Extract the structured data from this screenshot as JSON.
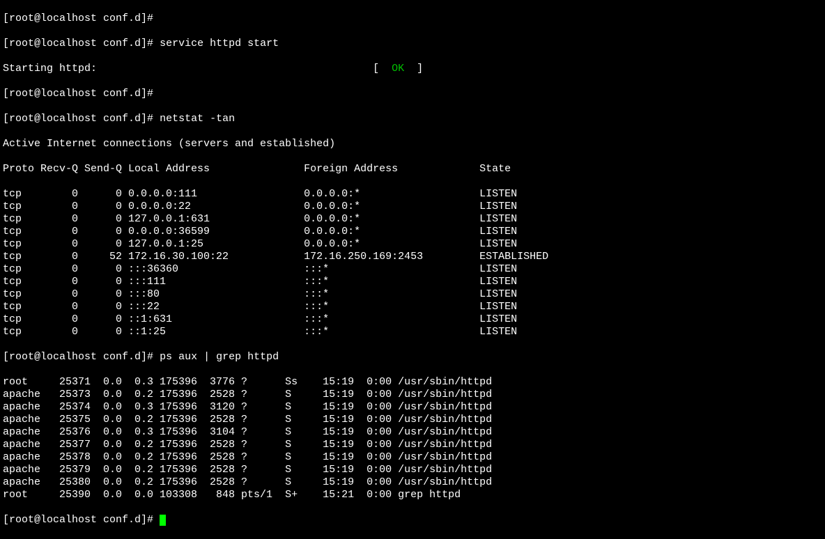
{
  "prompt": "[root@localhost conf.d]#",
  "cmd_service": "service httpd start",
  "starting_line": "Starting httpd:",
  "ok_left": "[",
  "ok_text": "  OK  ",
  "ok_right": "]",
  "cmd_netstat": "netstat -tan",
  "netstat_title": "Active Internet connections (servers and established)",
  "netstat_header": {
    "proto": "Proto",
    "recvq": "Recv-Q",
    "sendq": "Send-Q",
    "local": "Local Address",
    "foreign": "Foreign Address",
    "state": "State"
  },
  "netstat_rows": [
    {
      "proto": "tcp",
      "recvq": "0",
      "sendq": "0",
      "local": "0.0.0.0:111",
      "foreign": "0.0.0.0:*",
      "state": "LISTEN"
    },
    {
      "proto": "tcp",
      "recvq": "0",
      "sendq": "0",
      "local": "0.0.0.0:22",
      "foreign": "0.0.0.0:*",
      "state": "LISTEN"
    },
    {
      "proto": "tcp",
      "recvq": "0",
      "sendq": "0",
      "local": "127.0.0.1:631",
      "foreign": "0.0.0.0:*",
      "state": "LISTEN"
    },
    {
      "proto": "tcp",
      "recvq": "0",
      "sendq": "0",
      "local": "0.0.0.0:36599",
      "foreign": "0.0.0.0:*",
      "state": "LISTEN"
    },
    {
      "proto": "tcp",
      "recvq": "0",
      "sendq": "0",
      "local": "127.0.0.1:25",
      "foreign": "0.0.0.0:*",
      "state": "LISTEN"
    },
    {
      "proto": "tcp",
      "recvq": "0",
      "sendq": "52",
      "local": "172.16.30.100:22",
      "foreign": "172.16.250.169:2453",
      "state": "ESTABLISHED"
    },
    {
      "proto": "tcp",
      "recvq": "0",
      "sendq": "0",
      "local": ":::36360",
      "foreign": ":::*",
      "state": "LISTEN"
    },
    {
      "proto": "tcp",
      "recvq": "0",
      "sendq": "0",
      "local": ":::111",
      "foreign": ":::*",
      "state": "LISTEN"
    },
    {
      "proto": "tcp",
      "recvq": "0",
      "sendq": "0",
      "local": ":::80",
      "foreign": ":::*",
      "state": "LISTEN"
    },
    {
      "proto": "tcp",
      "recvq": "0",
      "sendq": "0",
      "local": ":::22",
      "foreign": ":::*",
      "state": "LISTEN"
    },
    {
      "proto": "tcp",
      "recvq": "0",
      "sendq": "0",
      "local": "::1:631",
      "foreign": ":::*",
      "state": "LISTEN"
    },
    {
      "proto": "tcp",
      "recvq": "0",
      "sendq": "0",
      "local": "::1:25",
      "foreign": ":::*",
      "state": "LISTEN"
    }
  ],
  "cmd_ps": "ps aux | grep httpd",
  "ps_rows": [
    {
      "user": "root",
      "pid": "25371",
      "cpu": "0.0",
      "mem": "0.3",
      "vsz": "175396",
      "rss": "3776",
      "tty": "?",
      "stat": "Ss",
      "start": "15:19",
      "time": "0:00",
      "cmd": "/usr/sbin/httpd"
    },
    {
      "user": "apache",
      "pid": "25373",
      "cpu": "0.0",
      "mem": "0.2",
      "vsz": "175396",
      "rss": "2528",
      "tty": "?",
      "stat": "S",
      "start": "15:19",
      "time": "0:00",
      "cmd": "/usr/sbin/httpd"
    },
    {
      "user": "apache",
      "pid": "25374",
      "cpu": "0.0",
      "mem": "0.3",
      "vsz": "175396",
      "rss": "3120",
      "tty": "?",
      "stat": "S",
      "start": "15:19",
      "time": "0:00",
      "cmd": "/usr/sbin/httpd"
    },
    {
      "user": "apache",
      "pid": "25375",
      "cpu": "0.0",
      "mem": "0.2",
      "vsz": "175396",
      "rss": "2528",
      "tty": "?",
      "stat": "S",
      "start": "15:19",
      "time": "0:00",
      "cmd": "/usr/sbin/httpd"
    },
    {
      "user": "apache",
      "pid": "25376",
      "cpu": "0.0",
      "mem": "0.3",
      "vsz": "175396",
      "rss": "3104",
      "tty": "?",
      "stat": "S",
      "start": "15:19",
      "time": "0:00",
      "cmd": "/usr/sbin/httpd"
    },
    {
      "user": "apache",
      "pid": "25377",
      "cpu": "0.0",
      "mem": "0.2",
      "vsz": "175396",
      "rss": "2528",
      "tty": "?",
      "stat": "S",
      "start": "15:19",
      "time": "0:00",
      "cmd": "/usr/sbin/httpd"
    },
    {
      "user": "apache",
      "pid": "25378",
      "cpu": "0.0",
      "mem": "0.2",
      "vsz": "175396",
      "rss": "2528",
      "tty": "?",
      "stat": "S",
      "start": "15:19",
      "time": "0:00",
      "cmd": "/usr/sbin/httpd"
    },
    {
      "user": "apache",
      "pid": "25379",
      "cpu": "0.0",
      "mem": "0.2",
      "vsz": "175396",
      "rss": "2528",
      "tty": "?",
      "stat": "S",
      "start": "15:19",
      "time": "0:00",
      "cmd": "/usr/sbin/httpd"
    },
    {
      "user": "apache",
      "pid": "25380",
      "cpu": "0.0",
      "mem": "0.2",
      "vsz": "175396",
      "rss": "2528",
      "tty": "?",
      "stat": "S",
      "start": "15:19",
      "time": "0:00",
      "cmd": "/usr/sbin/httpd"
    },
    {
      "user": "root",
      "pid": "25390",
      "cpu": "0.0",
      "mem": "0.0",
      "vsz": "103308",
      "rss": "848",
      "tty": "pts/1",
      "stat": "S+",
      "start": "15:21",
      "time": "0:00",
      "cmd": "grep httpd"
    }
  ]
}
